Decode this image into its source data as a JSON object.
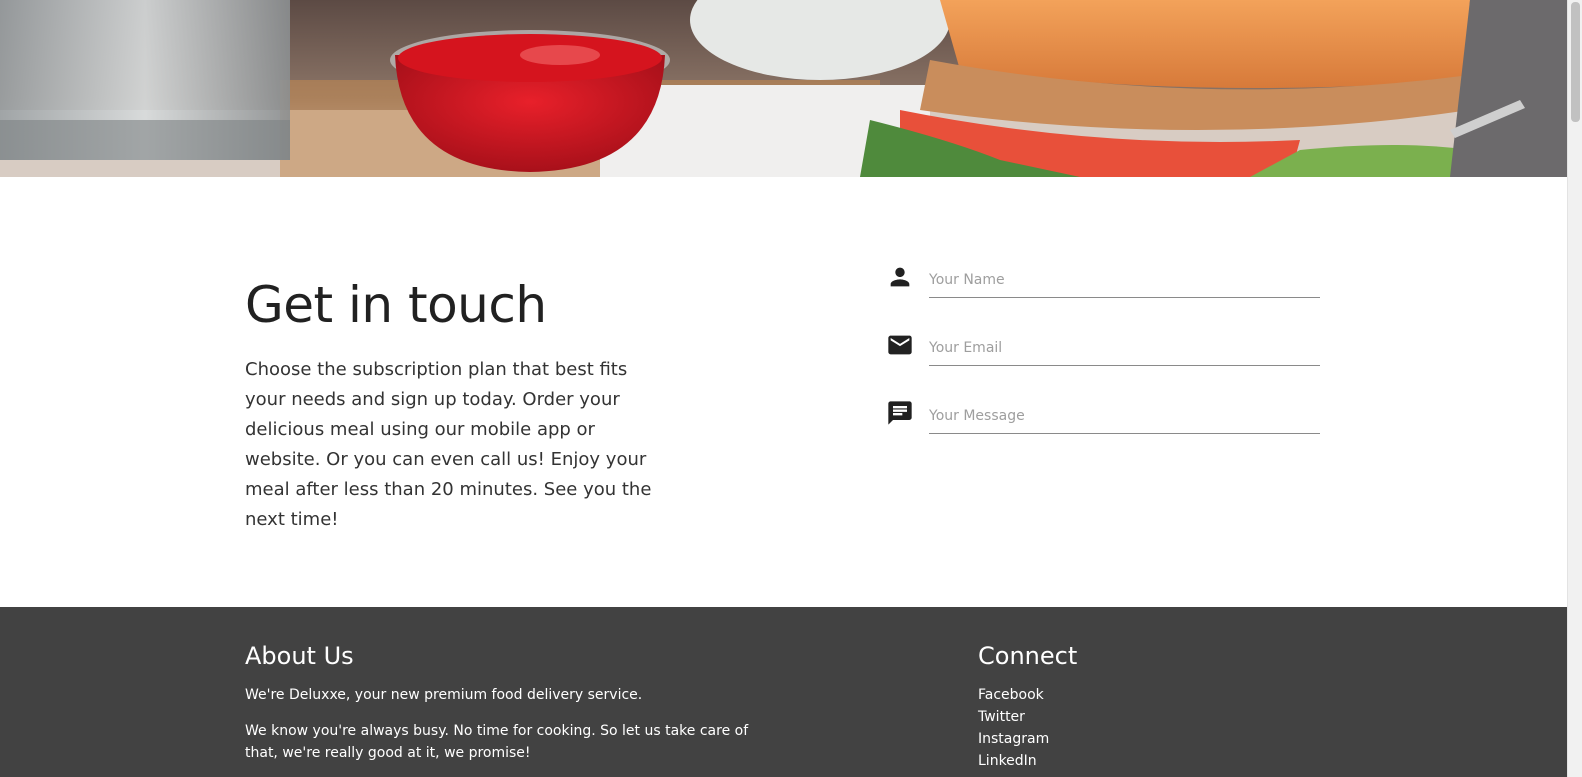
{
  "contact": {
    "title": "Get in touch",
    "description": "Choose the subscription plan that best fits your needs and sign up today. Order your delicious meal using our mobile app or website. Or you can even call us! Enjoy your meal after less than 20 minutes. See you the next time!",
    "fields": {
      "name": {
        "placeholder": "Your Name",
        "icon": "person-icon"
      },
      "email": {
        "placeholder": "Your Email",
        "icon": "mail-icon"
      },
      "message": {
        "placeholder": "Your Message",
        "icon": "message-icon"
      }
    }
  },
  "footer": {
    "about": {
      "title": "About Us",
      "p1": "We're Deluxxe, your new premium food delivery service.",
      "p2": "We know you're always busy. No time for cooking. So let us take care of that, we're really good at it, we promise!"
    },
    "connect": {
      "title": "Connect",
      "links": [
        "Facebook",
        "Twitter",
        "Instagram",
        "LinkedIn"
      ]
    }
  },
  "colors": {
    "footer_bg": "#424242",
    "text_dark": "#212121",
    "placeholder": "#9e9e9e"
  }
}
